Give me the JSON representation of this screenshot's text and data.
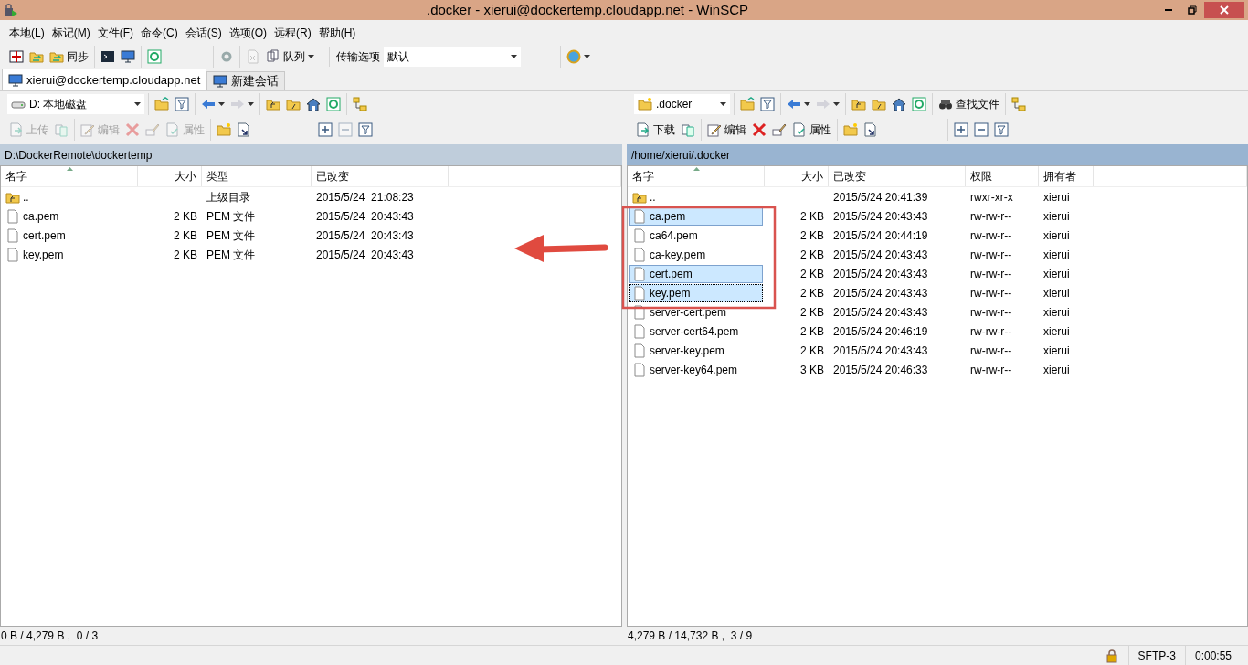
{
  "window": {
    "title": ".docker - xierui@dockertemp.cloudapp.net - WinSCP"
  },
  "menu": [
    "本地(L)",
    "标记(M)",
    "文件(F)",
    "命令(C)",
    "会话(S)",
    "选项(O)",
    "远程(R)",
    "帮助(H)"
  ],
  "toolbar": {
    "groups": [
      [
        {
          "disabled": false
        },
        {
          "disabled": false
        },
        {
          "label": "同步",
          "disabled": false
        }
      ],
      [
        {
          "disabled": false
        },
        {
          "disabled": false
        }
      ],
      [
        {
          "disabled": false
        }
      ],
      [
        {
          "disabled": false
        }
      ],
      [
        {
          "disabled": true
        },
        {
          "label": "队列",
          "dropdown": true,
          "disabled": false
        }
      ]
    ],
    "transfer_settings": {
      "label": "传输选项",
      "value": "默认"
    },
    "extra": [
      {
        "dropdown": true,
        "disabled": false
      }
    ]
  },
  "tabs": [
    {
      "label": "xierui@dockertemp.cloudapp.net",
      "selected": true
    },
    {
      "label": "新建会话",
      "selected": false
    }
  ],
  "panels": [
    {
      "active": false,
      "location": "D: 本地磁盘",
      "nav_groups": [
        [
          {
            "disabled": false
          },
          {
            "disabled": false
          }
        ],
        [
          {
            "dropdown": true,
            "disabled": false
          },
          {
            "dropdown": true,
            "disabled": true
          }
        ],
        [
          {
            "disabled": false
          },
          {
            "disabled": false
          },
          {
            "disabled": false
          },
          {
            "disabled": false
          }
        ],
        [
          {
            "disabled": false
          }
        ]
      ],
      "action_groups": [
        [
          {
            "label": "上传",
            "disabled": true
          },
          {
            "disabled": true
          }
        ],
        [
          {
            "label": "编辑",
            "disabled": true
          },
          {
            "disabled": true
          },
          {
            "disabled": true
          },
          {
            "label": "属性",
            "disabled": true
          }
        ],
        [
          {
            "disabled": false
          },
          {
            "disabled": false
          }
        ],
        [
          {
            "disabled": false
          },
          {
            "disabled": true
          },
          {
            "disabled": false
          }
        ]
      ],
      "path": "D:\\DockerRemote\\dockertemp",
      "columns": [
        {
          "label": "名字",
          "sorted": true
        },
        {
          "label": "大小",
          "sorted": false
        },
        {
          "label": "类型",
          "sorted": false
        },
        {
          "label": "已改变",
          "sorted": false
        }
      ],
      "rows": [
        {
          "kind": "parent",
          "name": "..",
          "type": "上级目录",
          "modified": "2015/5/24  21:08:23",
          "selected": false,
          "focused": false
        },
        {
          "kind": "file",
          "name": "ca.pem",
          "size": "2 KB",
          "type": "PEM 文件",
          "modified": "2015/5/24  20:43:43",
          "selected": false,
          "focused": false
        },
        {
          "kind": "file",
          "name": "cert.pem",
          "size": "2 KB",
          "type": "PEM 文件",
          "modified": "2015/5/24  20:43:43",
          "selected": false,
          "focused": false
        },
        {
          "kind": "file",
          "name": "key.pem",
          "size": "2 KB",
          "type": "PEM 文件",
          "modified": "2015/5/24  20:43:43",
          "selected": false,
          "focused": false
        }
      ],
      "status": "0 B / 4,279 B ,  0 / 3"
    },
    {
      "active": true,
      "location": ".docker",
      "nav_groups": [
        [
          {
            "disabled": false
          },
          {
            "disabled": false
          }
        ],
        [
          {
            "dropdown": true,
            "disabled": false
          },
          {
            "dropdown": true,
            "disabled": true
          }
        ],
        [
          {
            "disabled": false
          },
          {
            "disabled": false
          },
          {
            "disabled": false
          },
          {
            "disabled": false
          }
        ],
        [
          {
            "label": "查找文件",
            "disabled": false
          }
        ],
        [
          {
            "disabled": false
          }
        ]
      ],
      "action_groups": [
        [
          {
            "label": "下载",
            "disabled": false
          },
          {
            "disabled": false
          }
        ],
        [
          {
            "label": "编辑",
            "disabled": false
          },
          {
            "disabled": false
          },
          {
            "disabled": false
          },
          {
            "label": "属性",
            "disabled": false
          }
        ],
        [
          {
            "disabled": false
          },
          {
            "disabled": false
          }
        ],
        [
          {
            "disabled": false
          },
          {
            "disabled": false
          },
          {
            "disabled": false
          }
        ]
      ],
      "path": "/home/xierui/.docker",
      "columns": [
        {
          "label": "名字",
          "sorted": true
        },
        {
          "label": "大小",
          "sorted": false
        },
        {
          "label": "已改变",
          "sorted": false
        },
        {
          "label": "权限",
          "sorted": false
        },
        {
          "label": "拥有者",
          "sorted": false
        }
      ],
      "rows": [
        {
          "kind": "parent",
          "name": "..",
          "modified": "2015/5/24 20:41:39",
          "permissions": "rwxr-xr-x",
          "owner": "xierui",
          "selected": false,
          "focused": false
        },
        {
          "kind": "file",
          "name": "ca.pem",
          "size": "2 KB",
          "modified": "2015/5/24 20:43:43",
          "permissions": "rw-rw-r--",
          "owner": "xierui",
          "selected": true,
          "focused": false
        },
        {
          "kind": "file",
          "name": "ca64.pem",
          "size": "2 KB",
          "modified": "2015/5/24 20:44:19",
          "permissions": "rw-rw-r--",
          "owner": "xierui",
          "selected": false,
          "focused": false
        },
        {
          "kind": "file",
          "name": "ca-key.pem",
          "size": "2 KB",
          "modified": "2015/5/24 20:43:43",
          "permissions": "rw-rw-r--",
          "owner": "xierui",
          "selected": false,
          "focused": false
        },
        {
          "kind": "file",
          "name": "cert.pem",
          "size": "2 KB",
          "modified": "2015/5/24 20:43:43",
          "permissions": "rw-rw-r--",
          "owner": "xierui",
          "selected": true,
          "focused": false
        },
        {
          "kind": "file",
          "name": "key.pem",
          "size": "2 KB",
          "modified": "2015/5/24 20:43:43",
          "permissions": "rw-rw-r--",
          "owner": "xierui",
          "selected": true,
          "focused": true
        },
        {
          "kind": "file",
          "name": "server-cert.pem",
          "size": "2 KB",
          "modified": "2015/5/24 20:43:43",
          "permissions": "rw-rw-r--",
          "owner": "xierui",
          "selected": false,
          "focused": false
        },
        {
          "kind": "file",
          "name": "server-cert64.pem",
          "size": "2 KB",
          "modified": "2015/5/24 20:46:19",
          "permissions": "rw-rw-r--",
          "owner": "xierui",
          "selected": false,
          "focused": false
        },
        {
          "kind": "file",
          "name": "server-key.pem",
          "size": "2 KB",
          "modified": "2015/5/24 20:43:43",
          "permissions": "rw-rw-r--",
          "owner": "xierui",
          "selected": false,
          "focused": false
        },
        {
          "kind": "file",
          "name": "server-key64.pem",
          "size": "3 KB",
          "modified": "2015/5/24 20:46:33",
          "permissions": "rw-rw-r--",
          "owner": "xierui",
          "selected": false,
          "focused": false
        }
      ],
      "status": "4,279 B / 14,732 B ,  3 / 9"
    }
  ],
  "status_bar": {
    "protocol": "SFTP-3",
    "elapsed": "0:00:55"
  }
}
